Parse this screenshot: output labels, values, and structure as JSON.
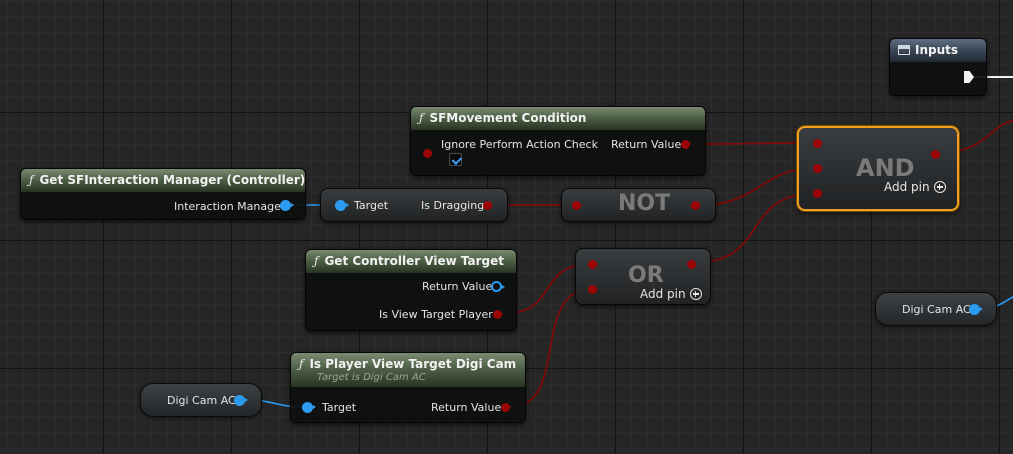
{
  "nodes": {
    "sf_movement": {
      "title": "SFMovement Condition",
      "in_label": "Ignore Perform Action Check",
      "ignore_checked": true,
      "out_label": "Return Value"
    },
    "interaction_mgr": {
      "title": "Get SFInteraction Manager (Controller)",
      "out_label": "Interaction Manager"
    },
    "is_dragging": {
      "in_label": "Target",
      "out_label": "Is Dragging"
    },
    "not_node": {
      "label": "NOT"
    },
    "and_node": {
      "label": "AND",
      "add_pin": "Add pin"
    },
    "or_node": {
      "label": "OR",
      "add_pin": "Add pin"
    },
    "controller_view": {
      "title": "Get Controller View Target",
      "out1_label": "Return Value",
      "out2_label": "Is View Target Player"
    },
    "player_view_digicam": {
      "title": "Is Player View Target Digi Cam",
      "subtitle": "Target is Digi Cam AC",
      "in_label": "Target",
      "out_label": "Return Value"
    },
    "digicam_var_left": {
      "label": "Digi Cam AC"
    },
    "digicam_var_right": {
      "label": "Digi Cam AC"
    },
    "inputs": {
      "title": "Inputs"
    }
  },
  "glyphs": {
    "function": "ƒ"
  },
  "colors": {
    "bool_pin": "#9c0505",
    "object_pin": "#2b9cf0",
    "exec_pin": "#f2f2f2",
    "selection": "#f0a020",
    "function_header": "#4e6047"
  }
}
